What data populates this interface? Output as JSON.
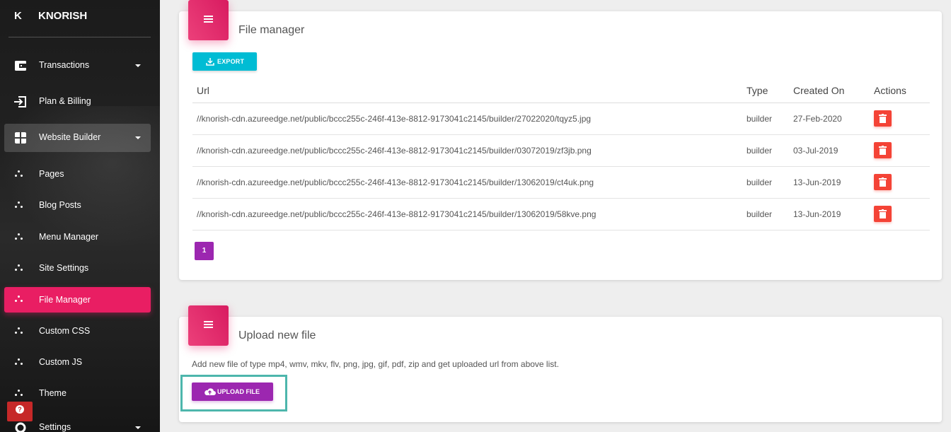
{
  "brand": {
    "mini": "K",
    "name": "KNORISH"
  },
  "sidebar": {
    "items": [
      {
        "label": "Transactions"
      },
      {
        "label": "Plan & Billing"
      },
      {
        "label": "Website Builder"
      },
      {
        "label": "Pages"
      },
      {
        "label": "Blog Posts"
      },
      {
        "label": "Menu Manager"
      },
      {
        "label": "Site Settings"
      },
      {
        "label": "File Manager"
      },
      {
        "label": "Custom CSS"
      },
      {
        "label": "Custom JS"
      },
      {
        "label": "Theme"
      },
      {
        "label": "Settings"
      }
    ]
  },
  "file_manager": {
    "title": "File manager",
    "export_label": "EXPORT",
    "columns": [
      "Url",
      "Type",
      "Created On",
      "Actions"
    ],
    "rows": [
      {
        "url": "//knorish-cdn.azureedge.net/public/bccc255c-246f-413e-8812-9173041c2145/builder/27022020/tqyz5.jpg",
        "type": "builder",
        "created": "27-Feb-2020"
      },
      {
        "url": "//knorish-cdn.azureedge.net/public/bccc255c-246f-413e-8812-9173041c2145/builder/03072019/zf3jb.png",
        "type": "builder",
        "created": "03-Jul-2019"
      },
      {
        "url": "//knorish-cdn.azureedge.net/public/bccc255c-246f-413e-8812-9173041c2145/builder/13062019/ct4uk.png",
        "type": "builder",
        "created": "13-Jun-2019"
      },
      {
        "url": "//knorish-cdn.azureedge.net/public/bccc255c-246f-413e-8812-9173041c2145/builder/13062019/58kve.png",
        "type": "builder",
        "created": "13-Jun-2019"
      }
    ],
    "page": "1"
  },
  "upload": {
    "title": "Upload new file",
    "description": "Add new file of type mp4, wmv, mkv, flv, png, jpg, gif, pdf, zip and get uploaded url from above list.",
    "button_label": "UPLOAD FILE"
  },
  "help_icon": "question-icon",
  "colors": {
    "accent": "#e91e63",
    "export": "#00bcd4",
    "upload": "#9c27b0",
    "delete": "#f44336",
    "highlight": "#4db6ac"
  }
}
